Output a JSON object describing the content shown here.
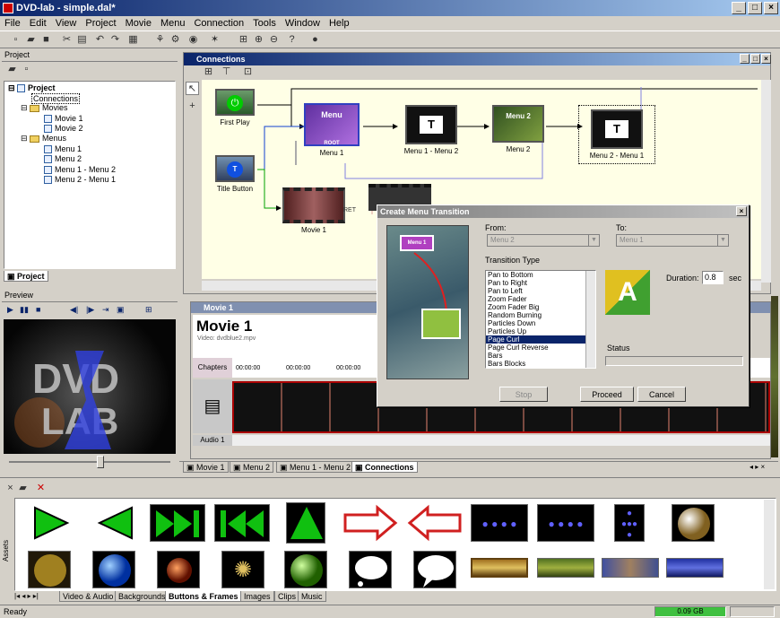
{
  "window": {
    "title": "DVD-lab - simple.dal*"
  },
  "menu": [
    "File",
    "Edit",
    "View",
    "Project",
    "Movie",
    "Menu",
    "Connection",
    "Tools",
    "Window",
    "Help"
  ],
  "project": {
    "title": "Project",
    "root": "Project",
    "connections": "Connections",
    "movies_folder": "Movies",
    "movies": [
      "Movie 1",
      "Movie 2"
    ],
    "menus_folder": "Menus",
    "menus": [
      "Menu 1",
      "Menu 2",
      "Menu 1 - Menu 2",
      "Menu 2 - Menu 1"
    ],
    "tab": "Project"
  },
  "preview": {
    "title": "Preview",
    "logo": "DVD LAB"
  },
  "connections": {
    "title": "Connections",
    "nodes": [
      "First Play",
      "Title Button",
      "Menu 1",
      "Menu 1 - Menu 2",
      "Menu 2",
      "Menu 2 - Menu 1",
      "Movie 1",
      "RET"
    ],
    "menu1_thumb": "Menu",
    "menu2_thumb": "Menu 2",
    "root_badge": "ROOT"
  },
  "movie": {
    "window_title": "Movie 1",
    "heading": "Movie 1",
    "video": "Video: dvdblue2.mpv",
    "chapters": "Chapters",
    "audio": "Audio 1",
    "times": [
      "00:00:00",
      "00:00:00",
      "00:00:00"
    ]
  },
  "dialog": {
    "title": "Create Menu Transition",
    "from_label": "From:",
    "from_value": "Menu 2",
    "to_label": "To:",
    "to_value": "Menu 1",
    "transition_label": "Transition Type",
    "transitions": [
      "Pan to Bottom",
      "Pan to Right",
      "Pan to Left",
      "Zoom Fader",
      "Zoom Fader Big",
      "Random Burning",
      "Particles Down",
      "Particles Up",
      "Page Curl",
      "Page Curl Reverse",
      "Bars",
      "Bars Blocks"
    ],
    "selected": "Page Curl",
    "duration_label": "Duration:",
    "duration_value": "0.8",
    "duration_unit": "sec",
    "status_label": "Status",
    "stop": "Stop",
    "proceed": "Proceed",
    "cancel": "Cancel",
    "thumb_label": "Menu 1",
    "letter": "A"
  },
  "doc_tabs": [
    "Movie 1",
    "Menu 2",
    "Menu 1 - Menu 2",
    "Connections"
  ],
  "assets": {
    "side_label": "Assets",
    "tabs": [
      "Video & Audio",
      "Backgrounds",
      "Buttons & Frames",
      "Images",
      "Clips",
      "Music"
    ],
    "active_tab": "Buttons & Frames"
  },
  "status": {
    "text": "Ready",
    "disk": "0.09 GB"
  },
  "colors": {
    "accent": "#0a246a",
    "canvas": "#ffffe6",
    "green": "#00c000"
  }
}
